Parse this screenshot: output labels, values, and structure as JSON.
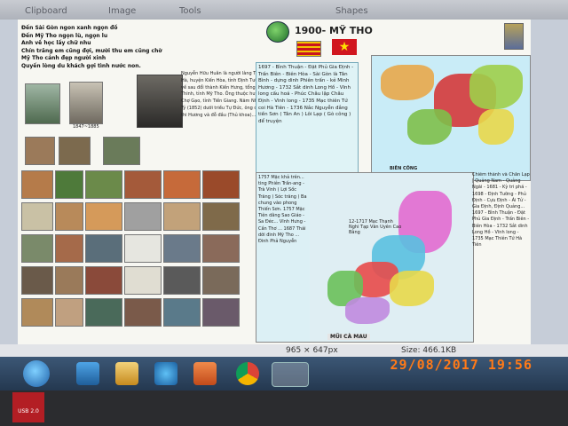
{
  "ribbon": {
    "tab1": "Clipboard",
    "tab2": "Image",
    "tab3": "Tools",
    "tab4": "Shapes"
  },
  "doc": {
    "title": "1900- MỸ THO",
    "poem": [
      "Đến Sài Gòn ngon xanh ngọn đồ",
      "Đến Mỹ Tho ngọn lù, ngọn lu",
      "Anh về học lấy chữ nhu",
      "Chín trăng em cũng đợi, mười thu em cũng chờ",
      "Mỹ Tho cảnh đẹp người xinh",
      "Quyến lòng du khách gợi tình nước non."
    ],
    "photo_years": "1847~1885",
    "bio": "Nguyễn Hữu Huân là người làng Tịnh Hà, huyện Kiến Hòa, tỉnh Định Tường; về sau đổi thành Kiến Hưng, tổng Hòa Thinh, tỉnh Mỹ Tho. Ông thuộc huyện Chợ Gạo, tỉnh Tiền Giang. Năm Nhâm Tý (1852) dưới triều Tự Đức, ông dự thi Hương và đỗ đầu (Thủ khoa)...",
    "hist_text": "1697 - Bình Thuận - Đặt Phủ Gia Định - Trấn Biên - Biên Hòa - Sài Gòn là Tân Bình - dựng dinh Phiên trấn - kẻ Minh Hương - 1732 Sắt dinh Long Hồ - Vĩnh long cấu hoá - Phúc Châu lập Châu Định - Vinh long - 1735 Mạc thiên Tứ coi Hà Tiên - 1736 Nắc Nguyễn đẳng tiền Sơn ( Tân An ) Lôi Lạp ( Gò công ) để truyện",
    "map1_label": "BIÊN CÔNG",
    "map2_bottom": "MŨI CÀ MAU",
    "map2_note": "12-1717 Mạc Thạnh Nghi Tạp Văn Uyên Cao Bằng",
    "side_text": "Chiêm thành và Chân Lạp | Quảng Nam - Quảng Ngãi - 1681 - Kỳ tri phá - 1698 - Định Tường - Phủ Định - Cựu Định - Ái Tử - Gia Định, Định Quảng... 1697 - Bình Thuận - Đặt Phủ Gia Định - Trấn Biên - Biên Hòa - 1732 Sắt dinh Long Hồ - Vĩnh long - 1735 Mạc Thiên Tứ Hà Tiên",
    "hist2_text": "1757 Mặc khả trên... ting Phiên Trấn-ang - Trà Vinh ( Lợi Sốc Trăng ) Sóc trăng ) Ba chung vào phong Thiến Sơn. 1757 Mặc Tiên dâng Sao Giáo - Sa Đéc... Vĩnh Hưng - Cần Thơ ... 1687 Thái dời đinh Mỹ Tho ... Đinh Phả Nguyễn"
  },
  "status": {
    "dimensions": "965 × 647px",
    "size": "Size: 466.1KB"
  },
  "taskbar": {
    "items": [
      "start-orb",
      "paint-icon",
      "explorer-icon",
      "ie-icon",
      "media-icon",
      "chrome-icon",
      "paint-active-icon"
    ]
  },
  "usb_label": "USB 2.0",
  "timestamp": "29/08/2017  19:56",
  "colors": {
    "timestamp": "#ff7a18",
    "taskbar": "#2d4762",
    "flag_red": "#d1161f",
    "flag_yellow": "#ffe100"
  }
}
